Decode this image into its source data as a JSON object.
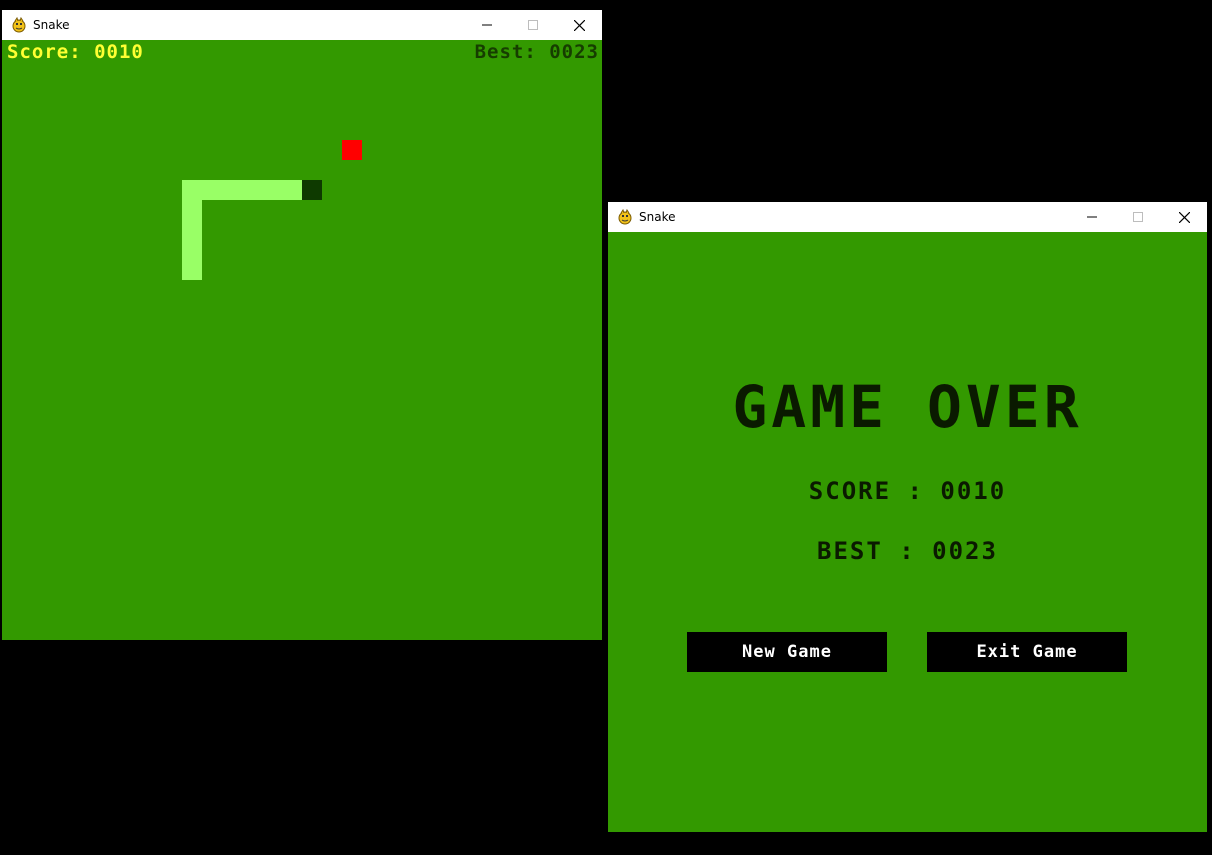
{
  "playing_window": {
    "title": "Snake",
    "hud": {
      "score": "Score: 0010",
      "best": "Best: 0023"
    }
  },
  "game_over_window": {
    "title": "Snake",
    "heading": "GAME OVER",
    "score_line": "SCORE : 0010",
    "best_line": "BEST : 0023",
    "new_game_label": "New Game",
    "exit_game_label": "Exit Game"
  },
  "colors": {
    "field": "#339900",
    "snake_body": "#99ff66",
    "snake_head": "#0e3a00",
    "food": "#ff0000",
    "score_text": "#ffff33",
    "best_text": "#163d00",
    "button_bg": "#000000",
    "button_text": "#ffffff"
  },
  "icons": [
    "app-icon",
    "minimize-icon",
    "maximize-icon",
    "close-icon"
  ]
}
